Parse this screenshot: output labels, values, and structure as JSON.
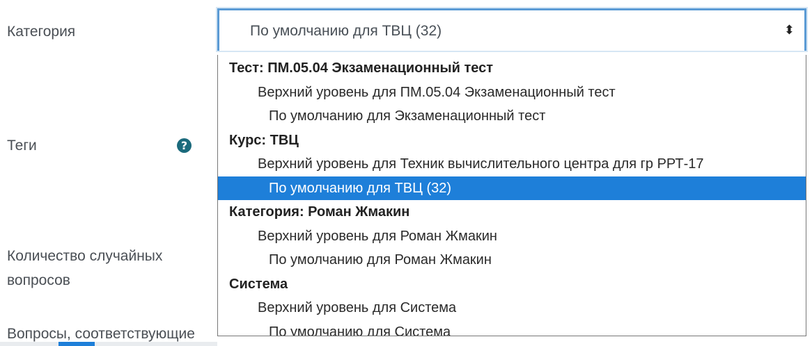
{
  "form": {
    "category_label": "Категория",
    "tags_label": "Теги",
    "random_label_line1": "Количество случайных",
    "random_label_line2": "вопросов",
    "matching_label": "Вопросы, соответствующие"
  },
  "select": {
    "value": "По умолчанию для ТВЦ (32)",
    "arrow": "⬍"
  },
  "help_icon": "?",
  "dropdown": {
    "options": [
      {
        "label": "Тест: ПМ.05.04 Экзаменационный тест",
        "kind": "group"
      },
      {
        "label": "Верхний уровень для ПМ.05.04 Экзаменационный тест",
        "kind": "lvl1"
      },
      {
        "label": "По умолчанию для Экзаменационный тест",
        "kind": "lvl2"
      },
      {
        "label": "Курс: ТВЦ",
        "kind": "group"
      },
      {
        "label": "Верхний уровень для Техник вычислительного центра для гр РРТ-17",
        "kind": "lvl1"
      },
      {
        "label": "По умолчанию для ТВЦ (32)",
        "kind": "lvl2",
        "selected": true
      },
      {
        "label": "Категория: Роман Жмакин",
        "kind": "group"
      },
      {
        "label": "Верхний уровень для Роман Жмакин",
        "kind": "lvl1"
      },
      {
        "label": "По умолчанию для Роман Жмакин",
        "kind": "lvl2"
      },
      {
        "label": "Система",
        "kind": "group"
      },
      {
        "label": "Верхний уровень для Система",
        "kind": "lvl1"
      },
      {
        "label": "По умолчанию для Система",
        "kind": "lvl2"
      }
    ]
  },
  "colors": {
    "selected_bg": "#1e7fd9",
    "focus_border": "#5b9bd5",
    "help_icon_bg": "#1b6a7c"
  }
}
